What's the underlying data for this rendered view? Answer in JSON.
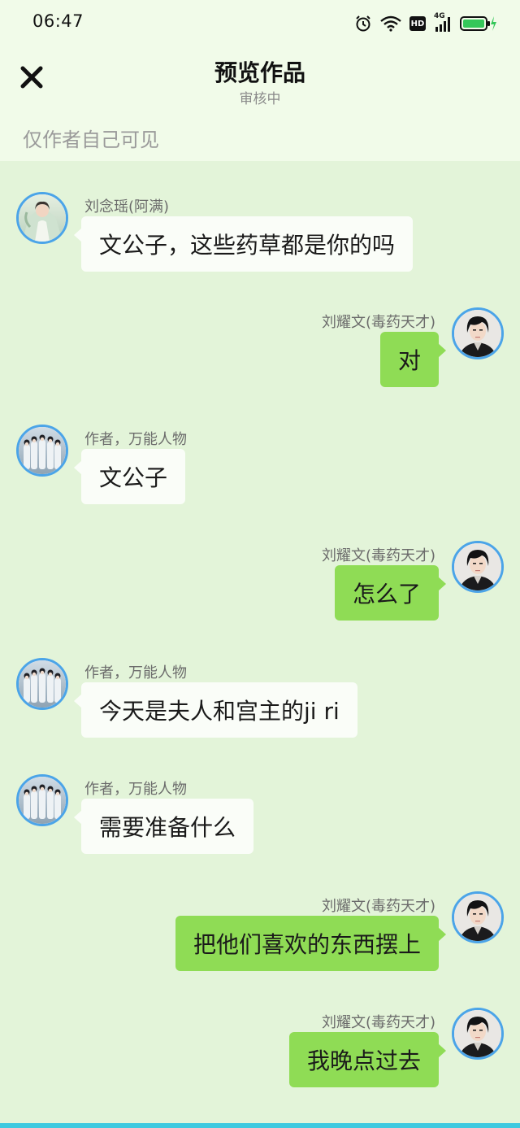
{
  "status_bar": {
    "time": "06:47",
    "icons": [
      "alarm-icon",
      "wifi-icon",
      "hd-badge",
      "signal-4g-icon",
      "battery-charging-icon"
    ],
    "hd_label": "HD",
    "network_label": "4G"
  },
  "header": {
    "close_icon": "close-icon",
    "title": "预览作品",
    "subtitle": "审核中",
    "visibility_note": "仅作者自己可见"
  },
  "colors": {
    "background": "#e3f4d9",
    "header_background": "#f1fbe9",
    "left_bubble": "#fafdf8",
    "right_bubble": "#8fdc55",
    "avatar_border": "#4ba4e8"
  },
  "messages": [
    {
      "side": "left",
      "sender": "刘念瑶(阿满)",
      "avatar": "liu-nianyao-avatar",
      "text": "文公子，这些药草都是你的吗"
    },
    {
      "side": "right",
      "sender": "刘耀文(毒药天才)",
      "avatar": "liu-yaowen-avatar",
      "text": "对"
    },
    {
      "side": "left",
      "sender": "作者，万能人物",
      "avatar": "author-group-avatar",
      "text": "文公子"
    },
    {
      "side": "right",
      "sender": "刘耀文(毒药天才)",
      "avatar": "liu-yaowen-avatar",
      "text": "怎么了"
    },
    {
      "side": "left",
      "sender": "作者，万能人物",
      "avatar": "author-group-avatar",
      "text": "今天是夫人和宫主的ji ri"
    },
    {
      "side": "left",
      "sender": "作者，万能人物",
      "avatar": "author-group-avatar",
      "text": "需要准备什么"
    },
    {
      "side": "right",
      "sender": "刘耀文(毒药天才)",
      "avatar": "liu-yaowen-avatar",
      "text": "把他们喜欢的东西摆上"
    },
    {
      "side": "right",
      "sender": "刘耀文(毒药天才)",
      "avatar": "liu-yaowen-avatar",
      "text": "我晚点过去"
    }
  ]
}
